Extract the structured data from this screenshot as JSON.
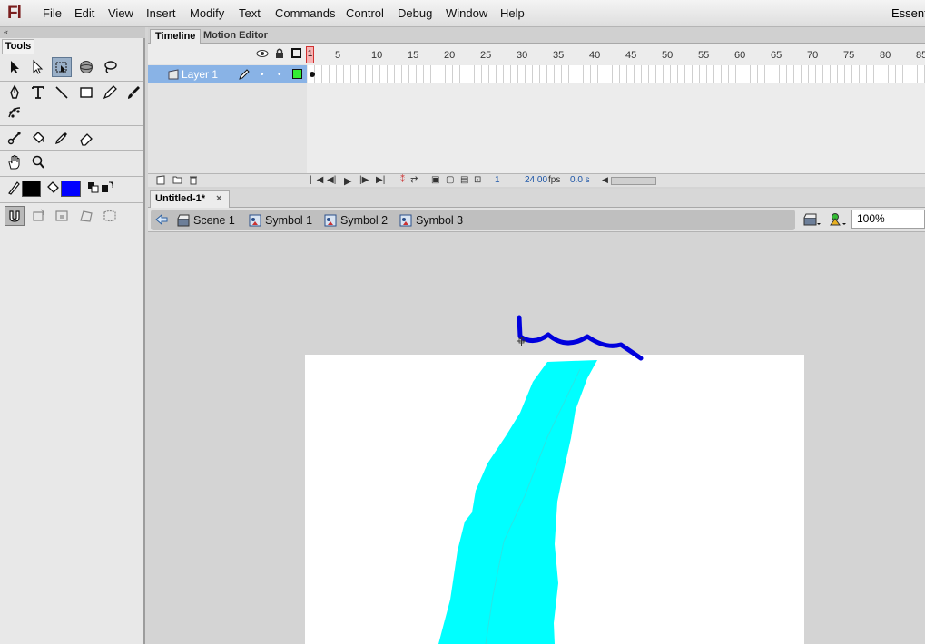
{
  "app": {
    "logo": "Fl"
  },
  "menu": {
    "items": [
      "File",
      "Edit",
      "View",
      "Insert",
      "Modify",
      "Text",
      "Commands",
      "Control",
      "Debug",
      "Window",
      "Help"
    ],
    "workspace": "Essenti"
  },
  "tools_panel": {
    "collapse_glyph": "«",
    "title": "Tools",
    "tools": [
      "selection-tool",
      "subselection-tool",
      "free-transform-tool",
      "3d-rotation-tool",
      "lasso-tool",
      "pen-tool",
      "text-tool",
      "line-tool",
      "rectangle-tool",
      "pencil-tool",
      "brush-tool",
      "deco-tool",
      "bone-tool",
      "paint-bucket-tool",
      "eyedropper-tool",
      "eraser-tool",
      "hand-tool",
      "zoom-tool"
    ],
    "active_tool": "free-transform-tool",
    "stroke_color": "#000000",
    "fill_color": "#0000ff"
  },
  "timeline": {
    "tabs": {
      "timeline": "Timeline",
      "motion_editor": "Motion Editor"
    },
    "layer_name": "Layer 1",
    "frame_labels": [
      "1",
      "5",
      "10",
      "15",
      "20",
      "25",
      "30",
      "35",
      "40",
      "45",
      "50",
      "55",
      "60",
      "65",
      "70",
      "75",
      "80",
      "85"
    ],
    "current_frame": "1",
    "fps": "24.00",
    "fps_unit": "fps",
    "time": "0.0 s"
  },
  "document": {
    "tab_title": "Untitled-1*",
    "close_glyph": "×"
  },
  "editbar": {
    "breadcrumb": [
      "Scene 1",
      "Symbol 1",
      "Symbol 2",
      "Symbol 3"
    ],
    "zoom": "100%"
  },
  "stage": {
    "background": "#ffffff",
    "shape_fill": "#00ffff",
    "stroke_color": "#0000dd"
  }
}
